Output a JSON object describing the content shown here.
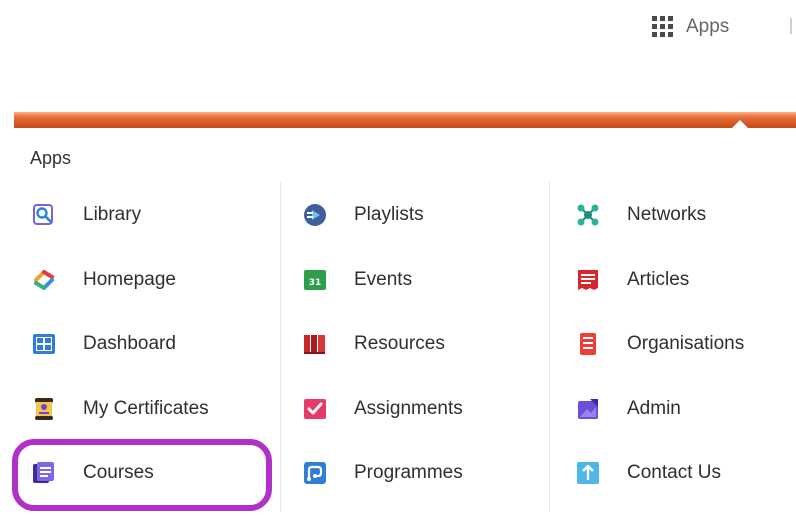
{
  "header": {
    "apps_label": "Apps",
    "icon": "grid-icon"
  },
  "menu": {
    "title": "Apps",
    "columns": [
      [
        {
          "label": "Library",
          "icon": "library-search-icon"
        },
        {
          "label": "Homepage",
          "icon": "homepage-icon"
        },
        {
          "label": "Dashboard",
          "icon": "dashboard-icon"
        },
        {
          "label": "My Certificates",
          "icon": "certificate-icon"
        },
        {
          "label": "Courses",
          "icon": "courses-icon"
        }
      ],
      [
        {
          "label": "Playlists",
          "icon": "playlists-icon"
        },
        {
          "label": "Events",
          "icon": "calendar-icon",
          "icon_text": "31"
        },
        {
          "label": "Resources",
          "icon": "resources-books-icon"
        },
        {
          "label": "Assignments",
          "icon": "assignments-check-icon"
        },
        {
          "label": "Programmes",
          "icon": "programmes-icon"
        }
      ],
      [
        {
          "label": "Networks",
          "icon": "networks-icon"
        },
        {
          "label": "Articles",
          "icon": "articles-icon"
        },
        {
          "label": "Organisations",
          "icon": "organisations-icon"
        },
        {
          "label": "Admin",
          "icon": "admin-icon"
        },
        {
          "label": "Contact Us",
          "icon": "contact-us-icon"
        }
      ]
    ]
  },
  "colors": {
    "accent_bar": "#d2561f",
    "highlight": "#b130c8"
  }
}
